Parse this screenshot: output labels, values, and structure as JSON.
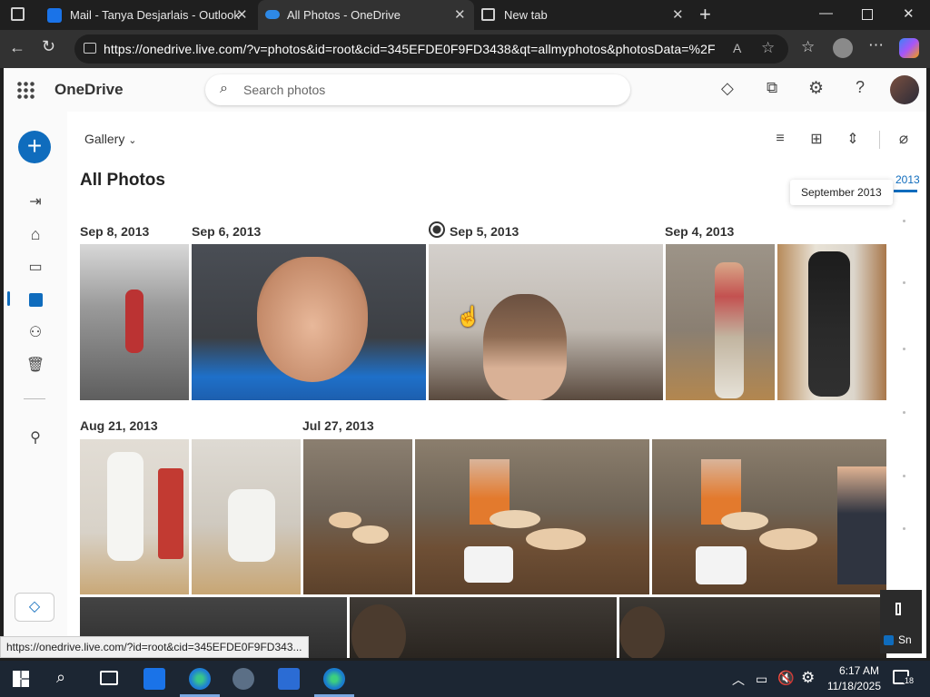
{
  "browser": {
    "tabs": [
      {
        "label": "Mail - Tanya Desjarlais - Outlook",
        "active": false
      },
      {
        "label": "All Photos - OneDrive",
        "active": true
      },
      {
        "label": "New tab",
        "active": false
      }
    ],
    "url": "https://onedrive.live.com/?v=photos&id=root&cid=345EFDE0F9FD3438&qt=allmyphotos&photosData=%2F"
  },
  "app": {
    "name": "OneDrive",
    "search_placeholder": "Search photos",
    "accent": "#0f6cbd"
  },
  "header": {
    "view_selector": "Gallery",
    "title": "All Photos"
  },
  "timeline": {
    "year_label": "2013",
    "tooltip": "September 2013"
  },
  "dates": {
    "d1": "Sep 8, 2013",
    "d2": "Sep 6, 2013",
    "d3": "Sep 5, 2013",
    "d4": "Sep 4, 2013",
    "d5": "Aug 21, 2013",
    "d6": "Jul 27, 2013"
  },
  "photos": [
    "boy on bike black and white",
    "smiling boy close-up",
    "boy with wet hair",
    "boy in plaid shirt",
    "boy in black t-shirt",
    "karate kick",
    "karate class",
    "kids making pizza 1",
    "kids making pizza 2",
    "kids making pizza 3"
  ],
  "status_url": "https://onedrive.live.com/?id=root&cid=345EFDE0F9FD343...",
  "side_widget": {
    "label": "Sn"
  },
  "taskbar": {
    "time": "6:17 AM",
    "date": "11/18/2025",
    "notifications": "18"
  }
}
